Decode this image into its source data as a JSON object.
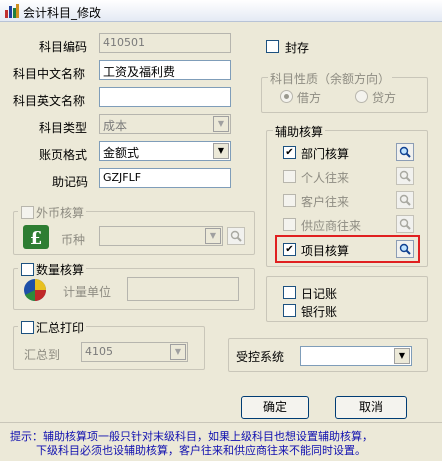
{
  "window": {
    "title": "会计科目_修改"
  },
  "form": {
    "code_label": "科目编码",
    "code_value": "410501",
    "cn_name_label": "科目中文名称",
    "cn_name_value": "工资及福利费",
    "en_name_label": "科目英文名称",
    "en_name_value": "",
    "type_label": "科目类型",
    "type_value": "成本",
    "format_label": "账页格式",
    "format_value": "金额式",
    "mnemonic_label": "助记码",
    "mnemonic_value": "GZJFLF"
  },
  "seal": {
    "label": "封存",
    "checked": false
  },
  "nature": {
    "title": "科目性质（余额方向）",
    "debit": "借方",
    "credit": "贷方",
    "selected": "debit"
  },
  "auxiliary": {
    "title": "辅助核算",
    "items": [
      {
        "label": "部门核算",
        "checked": true,
        "enabled": true
      },
      {
        "label": "个人往来",
        "checked": false,
        "enabled": false
      },
      {
        "label": "客户往来",
        "checked": false,
        "enabled": false
      },
      {
        "label": "供应商往来",
        "checked": false,
        "enabled": false
      },
      {
        "label": "项目核算",
        "checked": true,
        "enabled": true,
        "highlighted": true
      }
    ]
  },
  "foreign": {
    "title": "外币核算",
    "currency_label": "币种",
    "currency_value": ""
  },
  "quantity": {
    "title": "数量核算",
    "unit_label": "计量单位",
    "unit_value": ""
  },
  "summary": {
    "title": "汇总打印",
    "to_label": "汇总到",
    "to_value": "4105"
  },
  "journals": {
    "daily": "日记账",
    "bank": "银行账"
  },
  "controlled": {
    "label": "受控系统",
    "value": ""
  },
  "buttons": {
    "ok": "确定",
    "cancel": "取消"
  },
  "hint": {
    "line1": "提示：辅助核算项一般只针对末级科目，如果上级科目也想设置辅助核算，",
    "line2": "下级科目必须也设辅助核算，客户往来和供应商往来不能同时设置。"
  },
  "colors": {
    "highlight": "#e02020",
    "hint": "#1010b0"
  }
}
